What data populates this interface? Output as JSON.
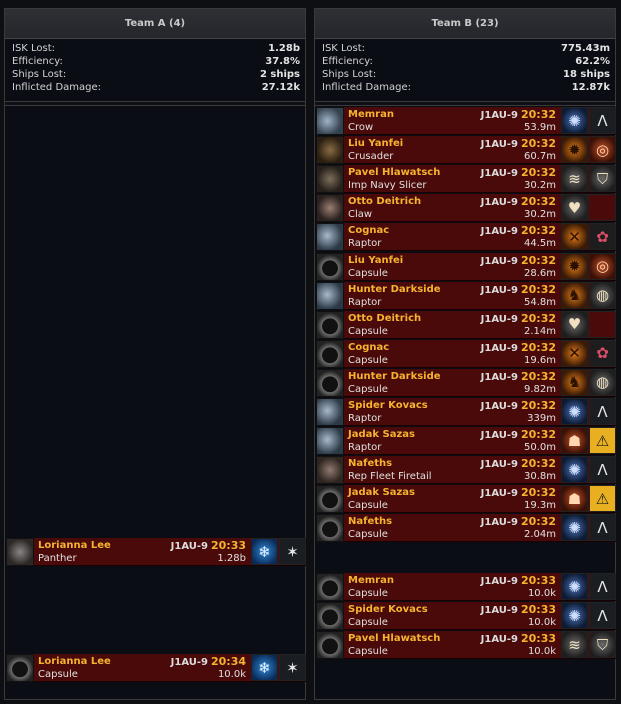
{
  "teamA": {
    "header": "Team A (4)",
    "stats": [
      {
        "label": "ISK Lost:",
        "value": "1.28b"
      },
      {
        "label": "Efficiency:",
        "value": "37.8%"
      },
      {
        "label": "Ships Lost:",
        "value": "2 ships"
      },
      {
        "label": "Inflicted Damage:",
        "value": "27.12k"
      }
    ],
    "kills": [
      {
        "pilot": "Lorianna Lee",
        "system": "J1AU-9",
        "time": "20:33",
        "ship": "Panther",
        "value": "1.28b",
        "corp_icon": "snowflake-icon",
        "alliance_icon": "star-icon"
      },
      {
        "pilot": "Lorianna Lee",
        "system": "J1AU-9",
        "time": "20:34",
        "ship": "Capsule",
        "value": "10.0k",
        "corp_icon": "snowflake-icon",
        "alliance_icon": "star-icon"
      }
    ]
  },
  "teamB": {
    "header": "Team B (23)",
    "stats": [
      {
        "label": "ISK Lost:",
        "value": "775.43m"
      },
      {
        "label": "Efficiency:",
        "value": "62.2%"
      },
      {
        "label": "Ships Lost:",
        "value": "18 ships"
      },
      {
        "label": "Inflicted Damage:",
        "value": "12.87k"
      }
    ],
    "kills": [
      {
        "pilot": "Memran",
        "system": "J1AU-9",
        "time": "20:32",
        "ship": "Crow",
        "value": "53.9m",
        "corp_icon": "blue-sigil-icon",
        "alliance_icon": "chevron-a-icon"
      },
      {
        "pilot": "Liu Yanfei",
        "system": "J1AU-9",
        "time": "20:32",
        "ship": "Crusader",
        "value": "60.7m",
        "corp_icon": "sun-gear-icon",
        "alliance_icon": "red-swirl-icon"
      },
      {
        "pilot": "Pavel Hlawatsch",
        "system": "J1AU-9",
        "time": "20:32",
        "ship": "Imp Navy Slicer",
        "value": "30.2m",
        "corp_icon": "wings-icon",
        "alliance_icon": "shield-icon"
      },
      {
        "pilot": "Otto Deitrich",
        "system": "J1AU-9",
        "time": "20:32",
        "ship": "Claw",
        "value": "30.2m",
        "corp_icon": "heart-icon",
        "alliance_icon": ""
      },
      {
        "pilot": "Cognac",
        "system": "J1AU-9",
        "time": "20:32",
        "ship": "Raptor",
        "value": "44.5m",
        "corp_icon": "crossed-axes-icon",
        "alliance_icon": "flower-icon"
      },
      {
        "pilot": "Liu Yanfei",
        "system": "J1AU-9",
        "time": "20:32",
        "ship": "Capsule",
        "value": "28.6m",
        "corp_icon": "sun-gear-icon",
        "alliance_icon": "red-swirl-icon"
      },
      {
        "pilot": "Hunter Darkside",
        "system": "J1AU-9",
        "time": "20:32",
        "ship": "Raptor",
        "value": "54.8m",
        "corp_icon": "horse-icon",
        "alliance_icon": "globe-icon"
      },
      {
        "pilot": "Otto Deitrich",
        "system": "J1AU-9",
        "time": "20:32",
        "ship": "Capsule",
        "value": "2.14m",
        "corp_icon": "heart-icon",
        "alliance_icon": ""
      },
      {
        "pilot": "Cognac",
        "system": "J1AU-9",
        "time": "20:32",
        "ship": "Capsule",
        "value": "19.6m",
        "corp_icon": "crossed-axes-icon",
        "alliance_icon": "flower-icon"
      },
      {
        "pilot": "Hunter Darkside",
        "system": "J1AU-9",
        "time": "20:32",
        "ship": "Capsule",
        "value": "9.82m",
        "corp_icon": "horse-icon",
        "alliance_icon": "globe-icon"
      },
      {
        "pilot": "Spider Kovacs",
        "system": "J1AU-9",
        "time": "20:32",
        "ship": "Raptor",
        "value": "339m",
        "corp_icon": "blue-sigil-icon",
        "alliance_icon": "chevron-a-icon"
      },
      {
        "pilot": "Jadak Sazas",
        "system": "J1AU-9",
        "time": "20:32",
        "ship": "Raptor",
        "value": "50.0m",
        "corp_icon": "monster-icon",
        "alliance_icon": "warning-sign-icon"
      },
      {
        "pilot": "Nafeths",
        "system": "J1AU-9",
        "time": "20:32",
        "ship": "Rep Fleet Firetail",
        "value": "30.8m",
        "corp_icon": "blue-sigil-icon",
        "alliance_icon": "chevron-a-icon"
      },
      {
        "pilot": "Jadak Sazas",
        "system": "J1AU-9",
        "time": "20:32",
        "ship": "Capsule",
        "value": "19.3m",
        "corp_icon": "monster-icon",
        "alliance_icon": "warning-sign-icon"
      },
      {
        "pilot": "Nafeths",
        "system": "J1AU-9",
        "time": "20:32",
        "ship": "Capsule",
        "value": "2.04m",
        "corp_icon": "blue-sigil-icon",
        "alliance_icon": "chevron-a-icon"
      },
      {
        "pilot": "Memran",
        "system": "J1AU-9",
        "time": "20:33",
        "ship": "Capsule",
        "value": "10.0k",
        "corp_icon": "blue-sigil-icon",
        "alliance_icon": "chevron-a-icon"
      },
      {
        "pilot": "Spider Kovacs",
        "system": "J1AU-9",
        "time": "20:33",
        "ship": "Capsule",
        "value": "10.0k",
        "corp_icon": "blue-sigil-icon",
        "alliance_icon": "chevron-a-icon"
      },
      {
        "pilot": "Pavel Hlawatsch",
        "system": "J1AU-9",
        "time": "20:33",
        "ship": "Capsule",
        "value": "10.0k",
        "corp_icon": "wings-icon",
        "alliance_icon": "shield-icon"
      }
    ]
  }
}
